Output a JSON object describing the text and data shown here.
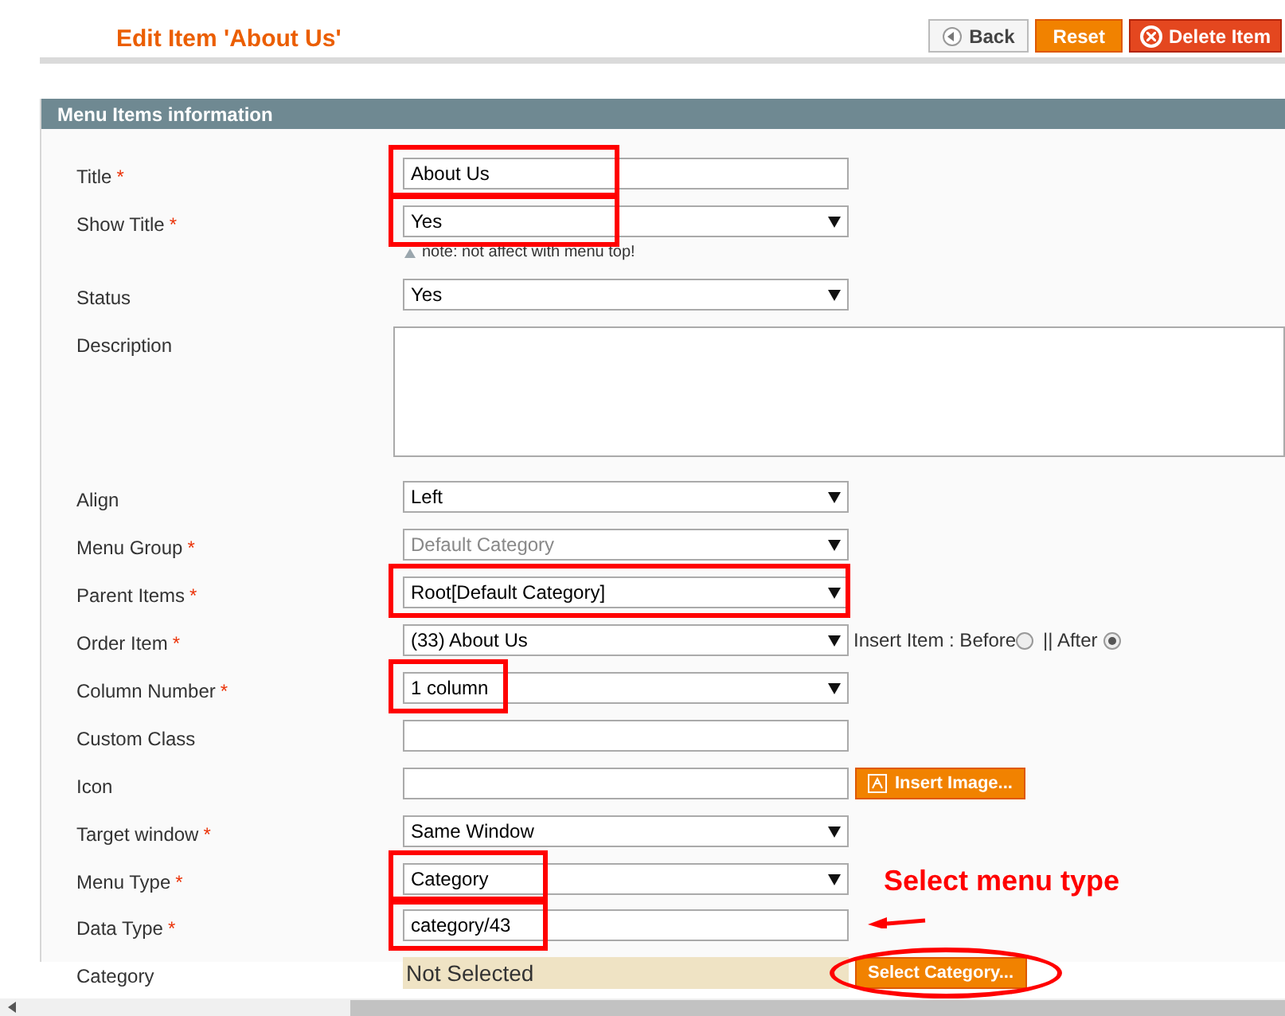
{
  "page_title": "Edit Item 'About Us'",
  "buttons": [
    {
      "label": "Back",
      "kind": "back"
    },
    {
      "label": "Reset",
      "kind": "reset"
    },
    {
      "label": "Delete Item",
      "kind": "delete"
    }
  ],
  "section": {
    "title": "Menu Items information"
  },
  "fields": [
    {
      "label": "Title",
      "required_mark": "*",
      "kind": "text",
      "value": "About Us",
      "highlight": {
        "kind": "long"
      }
    },
    {
      "label": "Show Title",
      "required_mark": "*",
      "kind": "select",
      "value": "Yes",
      "highlight": {
        "kind": "long"
      },
      "note": "note: not affect with menu top!"
    },
    {
      "label": "Status",
      "kind": "select",
      "value": "Yes"
    },
    {
      "label": "Description",
      "kind": "textarea"
    },
    {
      "label": "Align",
      "kind": "select",
      "value": "Left"
    },
    {
      "label": "Menu Group",
      "required_mark": "*",
      "kind": "select",
      "value": "Default Category",
      "disabled": true
    },
    {
      "label": "Parent Items",
      "required_mark": "*",
      "kind": "select",
      "value": "Root[Default Category]",
      "highlight": {
        "kind": "full"
      }
    },
    {
      "label": "Order Item",
      "required_mark": "*",
      "kind": "select",
      "value": "(33) About Us",
      "insert": {
        "label": "Insert Item : Before",
        "separator": "|| After",
        "before_selected": false,
        "after_selected": true
      }
    },
    {
      "label": "Column Number",
      "required_mark": "*",
      "kind": "select",
      "value": "1 column",
      "highlight": {
        "kind": "short"
      }
    },
    {
      "label": "Custom Class",
      "kind": "text"
    },
    {
      "label": "Icon",
      "kind": "text",
      "button": {
        "label": "Insert Image..."
      }
    },
    {
      "label": "Target window",
      "required_mark": "*",
      "kind": "select",
      "value": "Same Window"
    },
    {
      "label": "Menu Type",
      "required_mark": "*",
      "kind": "select",
      "value": "Category",
      "highlight": {
        "kind": "medium"
      }
    },
    {
      "label": "Data Type",
      "required_mark": "*",
      "kind": "text",
      "value": "category/43",
      "highlight": {
        "kind": "medium"
      }
    },
    {
      "label": "Category",
      "kind": "category",
      "value": "Not Selected",
      "button": {
        "label": "Select Category...",
        "circled": true
      }
    }
  ],
  "annotation": {
    "text": "Select menu type"
  }
}
